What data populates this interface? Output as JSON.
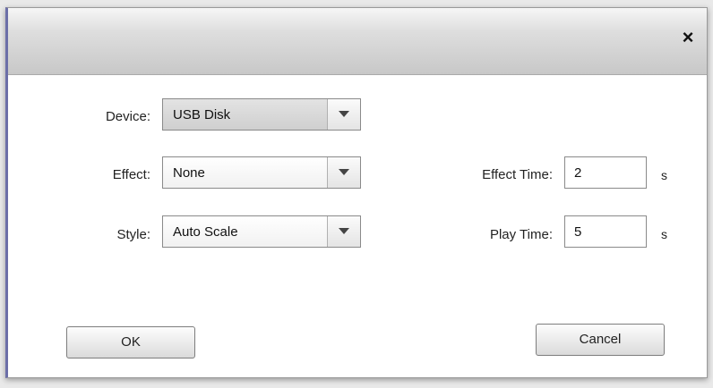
{
  "dialog": {
    "close_label": "×"
  },
  "form": {
    "device": {
      "label": "Device:",
      "value": "USB Disk"
    },
    "effect": {
      "label": "Effect:",
      "value": "None"
    },
    "style": {
      "label": "Style:",
      "value": "Auto Scale"
    },
    "effect_time": {
      "label": "Effect Time:",
      "value": "2",
      "unit": "s"
    },
    "play_time": {
      "label": "Play Time:",
      "value": "5",
      "unit": "s"
    }
  },
  "buttons": {
    "ok_label": "OK",
    "cancel_label": "Cancel"
  },
  "icons": {
    "dropdown": "chevron-down-icon",
    "close": "close-icon"
  }
}
